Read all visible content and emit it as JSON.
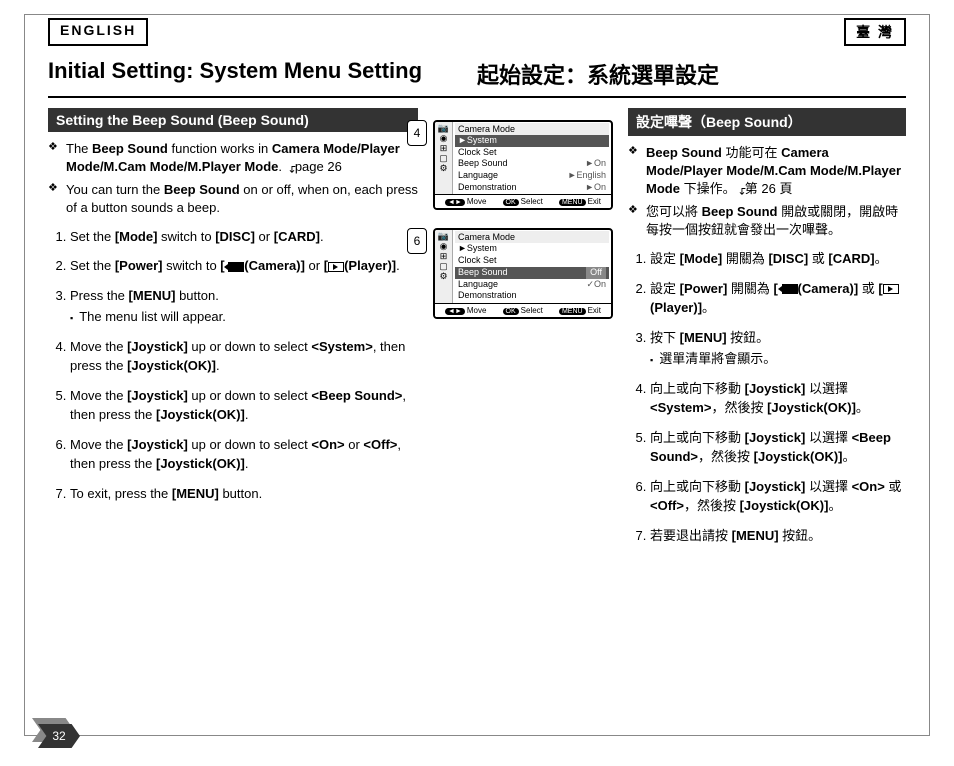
{
  "lang": {
    "left": "ENGLISH",
    "right": "臺 灣"
  },
  "title": {
    "en": "Initial Setting: System Menu Setting",
    "zh": "起始設定：系統選單設定"
  },
  "section": {
    "en": "Setting the Beep Sound (Beep Sound)",
    "zh": "設定嗶聲（Beep Sound）"
  },
  "page_ref": "page 26",
  "page_ref_zh": "第 26 頁",
  "bullets_en": {
    "b1_pre": "The ",
    "b1_bold1": "Beep Sound",
    "b1_mid": " function works in ",
    "b1_bold2": "Camera Mode/Player Mode/M.Cam Mode/M.Player Mode",
    "b1_post": ". ",
    "b2_pre": "You can turn the ",
    "b2_bold": "Beep Sound",
    "b2_post": " on or off, when on, each press of a button sounds a beep."
  },
  "bullets_zh": {
    "b1_bold1": "Beep Sound",
    "b1_mid": " 功能可在 ",
    "b1_bold2": "Camera Mode/Player Mode/M.Cam Mode/M.Player Mode",
    "b1_post": " 下操作。",
    "b2_pre": "您可以將 ",
    "b2_bold": "Beep Sound",
    "b2_post": " 開啟或關閉，開啟時每按一個按鈕就會發出一次嗶聲。"
  },
  "steps_en": {
    "s1a": "Set the ",
    "s1b": "[Mode]",
    "s1c": " switch to ",
    "s1d": "[DISC]",
    "s1e": " or ",
    "s1f": "[CARD]",
    "s1g": ".",
    "s2a": "Set the ",
    "s2b": "[Power]",
    "s2c": " switch to ",
    "s2d": "[",
    "s2e": "(Camera)]",
    "s2f": " or ",
    "s2g": "[",
    "s2h": "(Player)]",
    "s2i": ".",
    "s3a": "Press the ",
    "s3b": "[MENU]",
    "s3c": " button.",
    "s3sub": "The menu list will appear.",
    "s4a": "Move the ",
    "s4b": "[Joystick]",
    "s4c": " up or down to select ",
    "s4d": "<System>",
    "s4e": ", then press the ",
    "s4f": "[Joystick(OK)]",
    "s4g": ".",
    "s5a": "Move the ",
    "s5b": "[Joystick]",
    "s5c": " up or down to select ",
    "s5d": "<Beep Sound>",
    "s5e": ", then press the ",
    "s5f": "[Joystick(OK)]",
    "s5g": ".",
    "s6a": "Move the ",
    "s6b": "[Joystick]",
    "s6c": " up or down to select ",
    "s6d": "<On>",
    "s6e": " or ",
    "s6f": "<Off>",
    "s6g": ", then press the ",
    "s6h": "[Joystick(OK)]",
    "s6i": ".",
    "s7a": "To exit, press the ",
    "s7b": "[MENU]",
    "s7c": " button."
  },
  "steps_zh": {
    "s1a": "設定 ",
    "s1b": "[Mode]",
    "s1c": " 開關為 ",
    "s1d": "[DISC]",
    "s1e": " 或 ",
    "s1f": "[CARD]",
    "s1g": "。",
    "s2a": "設定 ",
    "s2b": "[Power]",
    "s2c": " 開關為 ",
    "s2d": "[",
    "s2e": "(Camera)]",
    "s2f": " 或 ",
    "s2g": "[",
    "s2h": "(Player)]",
    "s2i": "。",
    "s3a": "按下 ",
    "s3b": "[MENU]",
    "s3c": " 按鈕。",
    "s3sub": "選單清單將會顯示。",
    "s4a": "向上或向下移動 ",
    "s4b": "[Joystick]",
    "s4c": " 以選擇 ",
    "s4d": "<System>",
    "s4e": "，然後按 ",
    "s4f": "[Joystick(OK)]",
    "s4g": "。",
    "s5a": "向上或向下移動 ",
    "s5b": "[Joystick]",
    "s5c": " 以選擇 ",
    "s5d": "<Beep Sound>",
    "s5e": "，然後按 ",
    "s5f": "[Joystick(OK)]",
    "s5g": "。",
    "s6a": "向上或向下移動 ",
    "s6b": "[Joystick]",
    "s6c": " 以選擇 ",
    "s6d": "<On>",
    "s6e": " 或 ",
    "s6f": "<Off>",
    "s6g": "，然後按 ",
    "s6h": "[Joystick(OK)]",
    "s6i": "。",
    "s7a": "若要退出請按 ",
    "s7b": "[MENU]",
    "s7c": " 按鈕。"
  },
  "screen1": {
    "badge": "4",
    "title": "Camera Mode",
    "hi": "►System",
    "r1": "Clock Set",
    "r1v": "",
    "r2": "Beep Sound",
    "r2v": "►On",
    "r3": "Language",
    "r3v": "►English",
    "r4": "Demonstration",
    "r4v": "►On",
    "f_move": "Move",
    "f_select": "Select",
    "f_exit": "Exit",
    "p_move": "◄►",
    "p_ok": "OK",
    "p_menu": "MENU"
  },
  "screen2": {
    "badge": "6",
    "title": "Camera Mode",
    "sub": "►System",
    "r1": "Clock Set",
    "hi": "Beep Sound",
    "hi_v": "Off",
    "r3": "Language",
    "r3v": "✓On",
    "r4": "Demonstration",
    "f_move": "Move",
    "f_select": "Select",
    "f_exit": "Exit",
    "p_move": "◄►",
    "p_ok": "OK",
    "p_menu": "MENU"
  },
  "page_number": "32"
}
